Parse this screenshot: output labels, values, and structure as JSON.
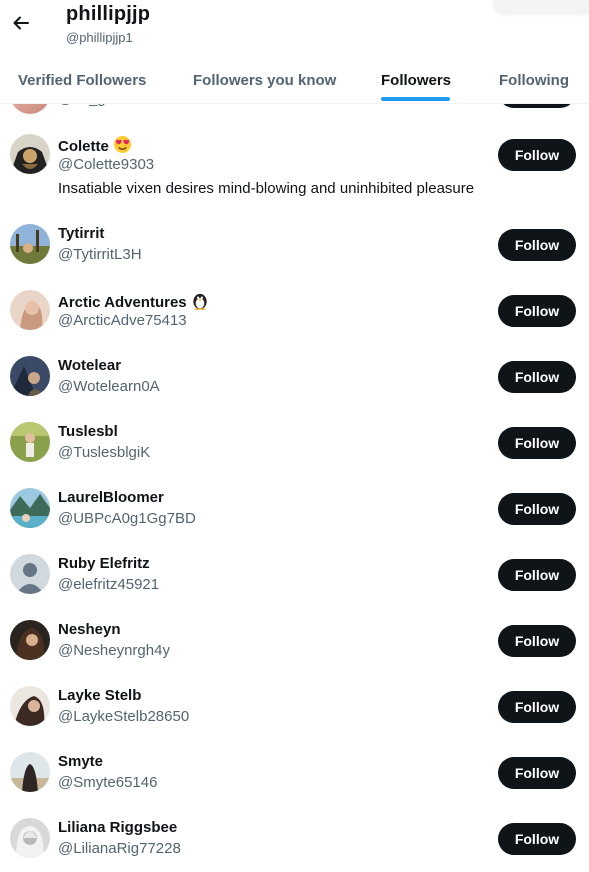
{
  "header": {
    "title": "phillipjjp",
    "handle": "@phillipjjp1"
  },
  "tabs": [
    {
      "label": "Verified Followers"
    },
    {
      "label": "Followers you know"
    },
    {
      "label": "Followers"
    },
    {
      "label": "Following"
    }
  ],
  "active_tab": "Followers",
  "partial_row": {
    "handle": "@ka_gane"
  },
  "users": [
    {
      "name": "Colette",
      "handle": "@Colette9303",
      "bio": "Insatiable vixen desires mind-blowing and uninhibited pleasure",
      "badge_icon": "heart-eyes-emoji-icon",
      "follow_label": "Follow"
    },
    {
      "name": "Tytirrit",
      "handle": "@TytirritL3H",
      "follow_label": "Follow"
    },
    {
      "name": "Arctic Adventures",
      "handle": "@ArcticAdve75413",
      "badge_icon": "penguin-emoji-icon",
      "follow_label": "Follow"
    },
    {
      "name": "Wotelear",
      "handle": "@Wotelearn0A",
      "follow_label": "Follow"
    },
    {
      "name": "Tuslesbl",
      "handle": "@TuslesblgiK",
      "follow_label": "Follow"
    },
    {
      "name": "LaurelBloomer",
      "handle": "@UBPcA0g1Gg7BD",
      "follow_label": "Follow"
    },
    {
      "name": "Ruby Elefritz",
      "handle": "@elefritz45921",
      "follow_label": "Follow"
    },
    {
      "name": "Nesheyn",
      "handle": "@Nesheynrgh4y",
      "follow_label": "Follow"
    },
    {
      "name": "Layke Stelb",
      "handle": "@LaykeStelb28650",
      "follow_label": "Follow"
    },
    {
      "name": "Smyte",
      "handle": "@Smyte65146",
      "follow_label": "Follow"
    },
    {
      "name": "Liliana Riggsbee",
      "handle": "@LilianaRig77228",
      "follow_label": "Follow"
    }
  ],
  "colors": {
    "accent": "#1d9bf0",
    "button_bg": "#0f1419",
    "secondary_text": "#536471"
  }
}
